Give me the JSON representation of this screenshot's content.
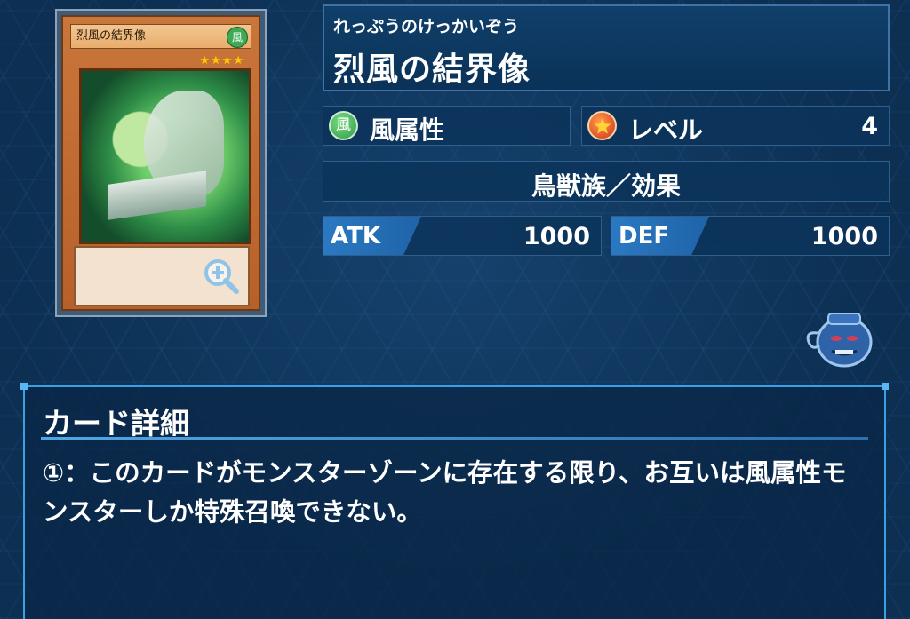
{
  "card_image": {
    "name": "烈風の結界像",
    "attribute_glyph": "風",
    "stars": "★★★★",
    "zoom_icon": "zoom-in-icon"
  },
  "card": {
    "reading": "れっぷうのけっかいぞう",
    "name": "烈風の結界像",
    "attribute": {
      "glyph": "風",
      "label": "風属性",
      "color": "#2c9b45"
    },
    "level": {
      "label": "レベル",
      "value": "4",
      "icon": "star-icon"
    },
    "type": "鳥獣族／効果",
    "atk": {
      "label": "ATK",
      "value": "1000"
    },
    "def": {
      "label": "DEF",
      "value": "1000"
    }
  },
  "detail": {
    "title": "カード詳細",
    "text": "①：このカードがモンスターゾーンに存在する限り、お互いは風属性モンスターしか特殊召喚できない。"
  },
  "colors": {
    "background": "#0c2f52",
    "accent": "#3aa0e6",
    "tab_blue": "#2b79c2"
  }
}
